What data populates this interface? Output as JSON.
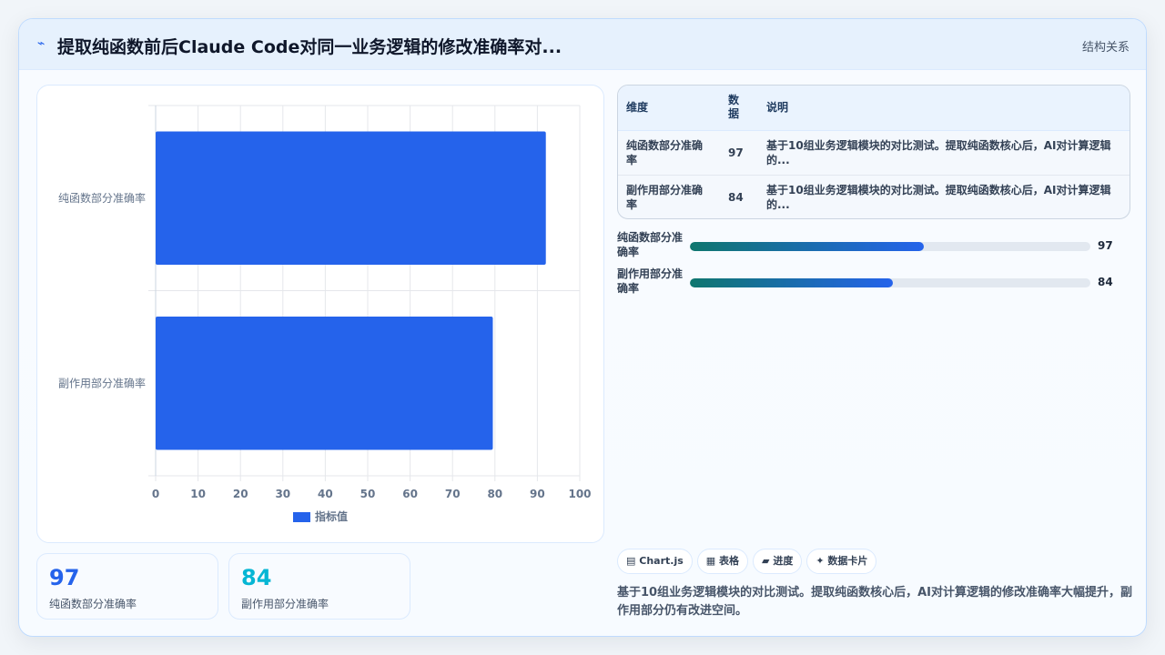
{
  "header": {
    "logo_icon": "sparkle-icon",
    "title": "提取纯函数前后Claude Code对同一业务逻辑的修改准确率对...",
    "tag": "结构关系"
  },
  "colors": {
    "accent": "#2563eb",
    "accent2": "#06b6d4",
    "teal": "#0f766e"
  },
  "chart_data": {
    "type": "bar",
    "orientation": "horizontal",
    "categories": [
      "纯函数部分准确率",
      "副作用部分准确率"
    ],
    "series": [
      {
        "name": "指标值",
        "values": [
          92,
          79.5
        ],
        "color": "#2563eb"
      }
    ],
    "xlim": [
      0,
      100
    ],
    "xticks": [
      "0",
      "10",
      "20",
      "30",
      "40",
      "50",
      "60",
      "70",
      "80",
      "90",
      "100"
    ],
    "grid": true,
    "legend": "bottom"
  },
  "stats": [
    {
      "value": "97",
      "label": "纯函数部分准确率",
      "color": "#2563eb"
    },
    {
      "value": "84",
      "label": "副作用部分准确率",
      "color": "#06b6d4"
    }
  ],
  "table": {
    "headers": [
      "维度",
      "数据",
      "说明"
    ],
    "rows": [
      {
        "dim": "纯函数部分准确率",
        "value": "97",
        "desc": "基于10组业务逻辑模块的对比测试。提取纯函数核心后，AI对计算逻辑的..."
      },
      {
        "dim": "副作用部分准确率",
        "value": "84",
        "desc": "基于10组业务逻辑模块的对比测试。提取纯函数核心后，AI对计算逻辑的..."
      }
    ]
  },
  "progress": [
    {
      "label": "纯函数部分准确率",
      "value": "97",
      "fraction": 0.585
    },
    {
      "label": "副作用部分准确率",
      "value": "84",
      "fraction": 0.506
    }
  ],
  "chips": [
    {
      "icon": "chart-icon",
      "glyph": "▤",
      "label": "Chart.js"
    },
    {
      "icon": "table-icon",
      "glyph": "▦",
      "label": "表格"
    },
    {
      "icon": "progress-icon",
      "glyph": "▰",
      "label": "进度"
    },
    {
      "icon": "card-icon",
      "glyph": "✦",
      "label": "数据卡片"
    }
  ],
  "note": "基于10组业务逻辑模块的对比测试。提取纯函数核心后，AI对计算逻辑的修改准确率大幅提升，副作用部分仍有改进空间。"
}
